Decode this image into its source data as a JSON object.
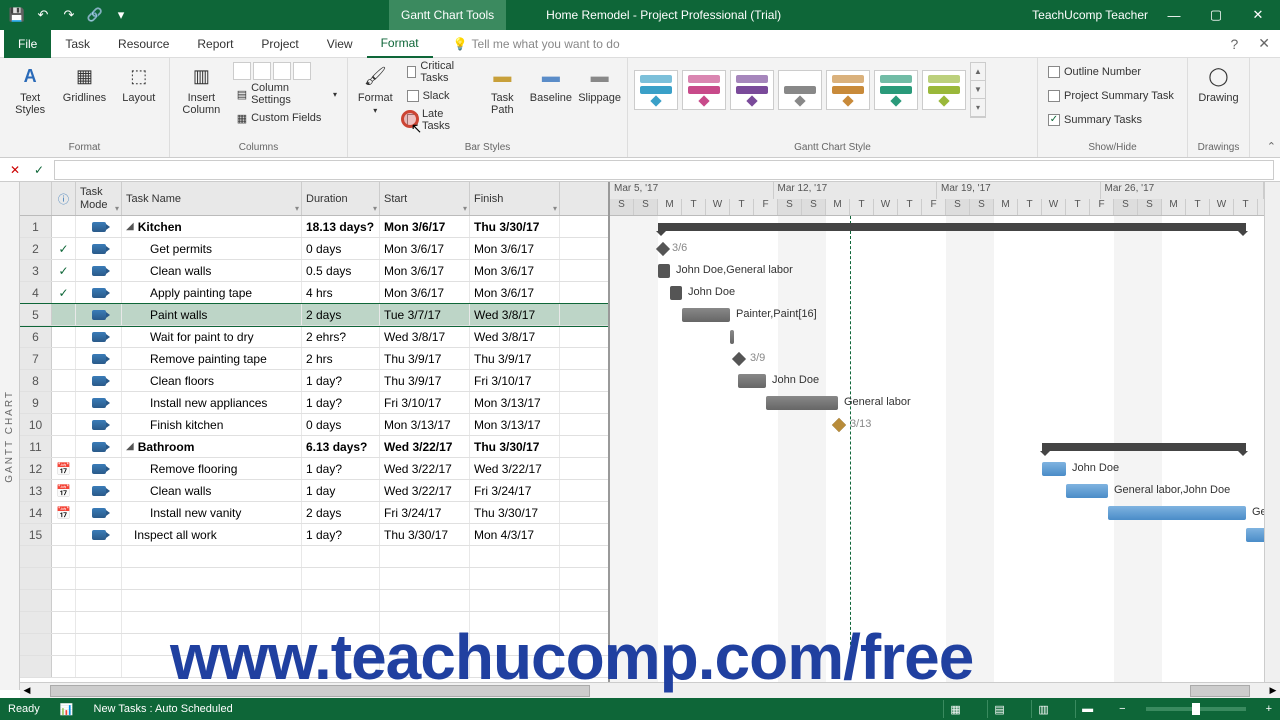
{
  "title": {
    "tools": "Gantt Chart Tools",
    "doc": "Home Remodel  -  Project Professional (Trial)",
    "user": "TeachUcomp Teacher"
  },
  "tabs": [
    "File",
    "Task",
    "Resource",
    "Report",
    "Project",
    "View",
    "Format"
  ],
  "active_tab": "Format",
  "tell_me": "Tell me what you want to do",
  "ribbon": {
    "format_group": "Format",
    "text_styles": "Text\nStyles",
    "gridlines": "Gridlines",
    "layout": "Layout",
    "columns_group": "Columns",
    "insert_column": "Insert\nColumn",
    "column_settings": "Column Settings",
    "custom_fields": "Custom Fields",
    "barstyles_group": "Bar Styles",
    "format_btn": "Format",
    "critical": "Critical Tasks",
    "slack": "Slack",
    "late": "Late Tasks",
    "task_path": "Task\nPath",
    "baseline": "Baseline",
    "slippage": "Slippage",
    "style_group": "Gantt Chart Style",
    "showhide_group": "Show/Hide",
    "outline_number": "Outline Number",
    "proj_summary": "Project Summary Task",
    "summary_tasks": "Summary Tasks",
    "drawings_group": "Drawings",
    "drawing": "Drawing"
  },
  "columns": {
    "ind": "",
    "mode": "Task\nMode",
    "name": "Task Name",
    "dur": "Duration",
    "start": "Start",
    "finish": "Finish"
  },
  "rows": [
    {
      "n": 1,
      "ind": "",
      "name": "Kitchen",
      "dur": "18.13 days?",
      "start": "Mon 3/6/17",
      "finish": "Thu 3/30/17",
      "summary": true
    },
    {
      "n": 2,
      "ind": "✓",
      "name": "Get permits",
      "dur": "0 days",
      "start": "Mon 3/6/17",
      "finish": "Mon 3/6/17",
      "indent": 1
    },
    {
      "n": 3,
      "ind": "✓",
      "name": "Clean walls",
      "dur": "0.5 days",
      "start": "Mon 3/6/17",
      "finish": "Mon 3/6/17",
      "indent": 1
    },
    {
      "n": 4,
      "ind": "✓",
      "name": "Apply painting tape",
      "dur": "4 hrs",
      "start": "Mon 3/6/17",
      "finish": "Mon 3/6/17",
      "indent": 1
    },
    {
      "n": 5,
      "ind": "",
      "name": "Paint walls",
      "dur": "2 days",
      "start": "Tue 3/7/17",
      "finish": "Wed 3/8/17",
      "indent": 1,
      "selected": true
    },
    {
      "n": 6,
      "ind": "",
      "name": "Wait for paint to dry",
      "dur": "2 ehrs?",
      "start": "Wed 3/8/17",
      "finish": "Wed 3/8/17",
      "indent": 1
    },
    {
      "n": 7,
      "ind": "",
      "name": "Remove painting tape",
      "dur": "2 hrs",
      "start": "Thu 3/9/17",
      "finish": "Thu 3/9/17",
      "indent": 1
    },
    {
      "n": 8,
      "ind": "",
      "name": "Clean floors",
      "dur": "1 day?",
      "start": "Thu 3/9/17",
      "finish": "Fri 3/10/17",
      "indent": 1
    },
    {
      "n": 9,
      "ind": "",
      "name": "Install new appliances",
      "dur": "1 day?",
      "start": "Fri 3/10/17",
      "finish": "Mon 3/13/17",
      "indent": 1
    },
    {
      "n": 10,
      "ind": "",
      "name": "Finish kitchen",
      "dur": "0 days",
      "start": "Mon 3/13/17",
      "finish": "Mon 3/13/17",
      "indent": 1
    },
    {
      "n": 11,
      "ind": "",
      "name": "Bathroom",
      "dur": "6.13 days?",
      "start": "Wed 3/22/17",
      "finish": "Thu 3/30/17",
      "summary": true
    },
    {
      "n": 12,
      "ind": "📅",
      "name": "Remove flooring",
      "dur": "1 day?",
      "start": "Wed 3/22/17",
      "finish": "Wed 3/22/17",
      "indent": 1
    },
    {
      "n": 13,
      "ind": "📅",
      "name": "Clean walls",
      "dur": "1 day",
      "start": "Wed 3/22/17",
      "finish": "Fri 3/24/17",
      "indent": 1
    },
    {
      "n": 14,
      "ind": "📅",
      "name": "Install new vanity",
      "dur": "2 days",
      "start": "Fri 3/24/17",
      "finish": "Thu 3/30/17",
      "indent": 1
    },
    {
      "n": 15,
      "ind": "",
      "name": "Inspect all work",
      "dur": "1 day?",
      "start": "Thu 3/30/17",
      "finish": "Mon 4/3/17"
    }
  ],
  "timescale": {
    "weeks": [
      "Mar 5, '17",
      "Mar 12, '17",
      "Mar 19, '17",
      "Mar 26, '17"
    ],
    "days": [
      "S",
      "S",
      "M",
      "T",
      "W",
      "T",
      "F",
      "S",
      "S",
      "M",
      "T",
      "W",
      "T",
      "F",
      "S",
      "S",
      "M",
      "T",
      "W",
      "T",
      "F",
      "S",
      "S",
      "M",
      "T",
      "W",
      "T"
    ]
  },
  "bar_labels": {
    "r2": "3/6",
    "r3": "John Doe,General labor",
    "r4": "John Doe",
    "r5": "Painter,Paint[16]",
    "r7": "3/9",
    "r8": "John Doe",
    "r9": "General labor",
    "r10": "3/13",
    "r12": "John Doe",
    "r13": "General labor,John Doe",
    "r14": "Ge"
  },
  "status": {
    "ready": "Ready",
    "newtasks": "New Tasks : Auto Scheduled"
  },
  "side_label": "GANTT CHART",
  "watermark": "www.teachucomp.com/free",
  "style_colors": [
    "#3aa0c8",
    "#c84a8a",
    "#7a4a9a",
    "#888",
    "#c88a3a",
    "#2a9a7a",
    "#9ab83a"
  ]
}
